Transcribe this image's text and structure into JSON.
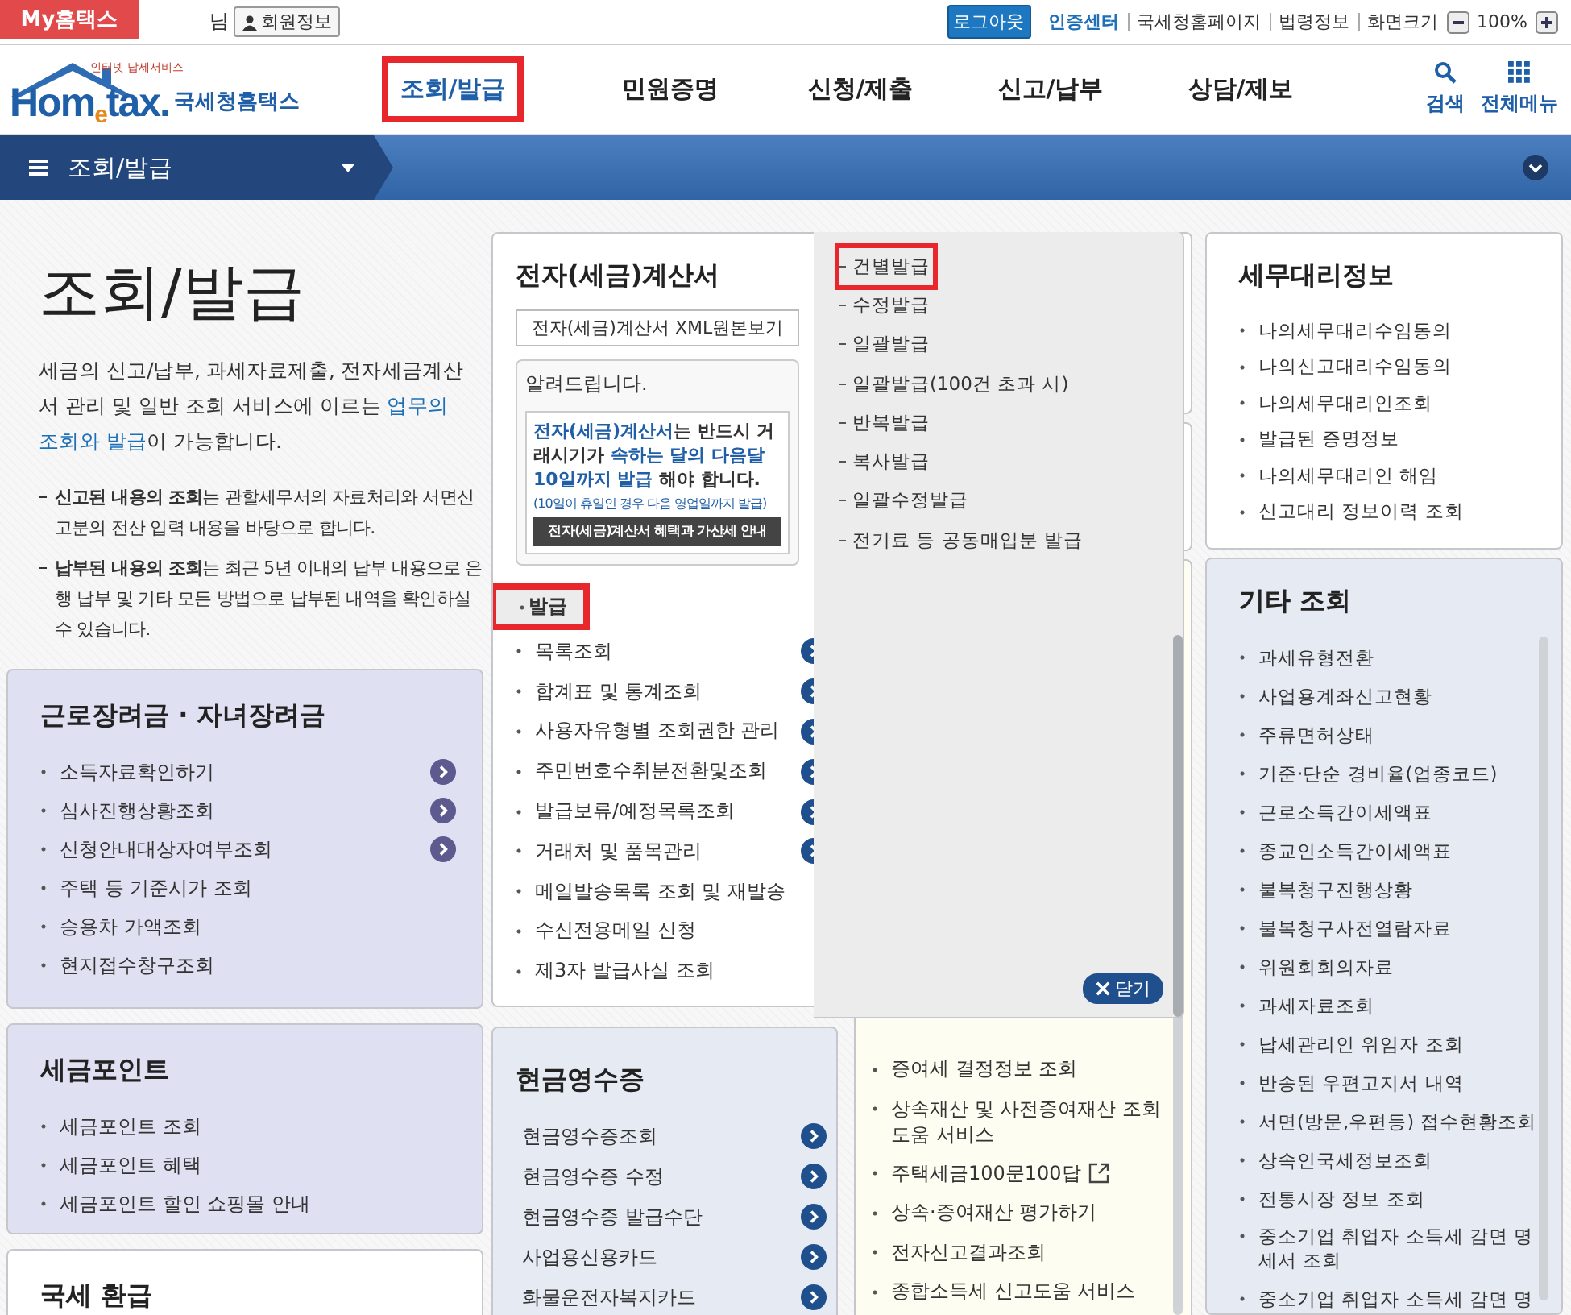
{
  "top_bar": {
    "my_button": "My홈택스",
    "user_suffix": "님",
    "member_button": "회원정보",
    "logout_button": "로그아웃",
    "links": [
      {
        "label": "인증센터",
        "emphasis": true
      },
      {
        "label": "국세청홈페이지",
        "emphasis": false
      },
      {
        "label": "법령정보",
        "emphasis": false
      }
    ],
    "zoom_label": "화면크기",
    "zoom_value": "100%"
  },
  "header": {
    "tagline": "인터넷 납세서비스",
    "wordmark": "Hom$_{e}$tax.",
    "site_name": "국세청홈택스",
    "nav": [
      {
        "label": "조회/발급",
        "selected": true,
        "highlighted": true
      },
      {
        "label": "민원증명",
        "selected": false,
        "highlighted": false
      },
      {
        "label": "신청/제출",
        "selected": false,
        "highlighted": false
      },
      {
        "label": "신고/납부",
        "selected": false,
        "highlighted": false
      },
      {
        "label": "상담/제보",
        "selected": false,
        "highlighted": false
      }
    ],
    "tools": [
      {
        "label": "검색",
        "kind": "search"
      },
      {
        "label": "전체메뉴",
        "kind": "menu"
      }
    ]
  },
  "section_bar": {
    "label": "조회/발급"
  },
  "intro": {
    "title": "조회/발급",
    "before": "세금의 신고/납부, 과세자료제출, 전자세금계산서 관리 및 일반 조회 서비스에 이르는 ",
    "link": "업무의 조회와 발급",
    "after": "이 가능합니다.",
    "notes": [
      "**신고된 내용의 조회**는 관할세무서의 자료처리와 서면신고분의 전산 입력 내용을 바탕으로 합니다.",
      "**납부된 내용의 조회**는 최근 5년 이내의 납부 내용으로 은행 납부 및 기타 모든 방법으로 납부된 내역을 확인하실 수 있습니다."
    ]
  },
  "left_cards": [
    {
      "title": "근로장려금 · 자녀장려금",
      "kind": "lavender",
      "items": [
        {
          "label": "소득자료확인하기",
          "has_arrow": true
        },
        {
          "label": "심사진행상황조회",
          "has_arrow": true
        },
        {
          "label": "신청안내대상자여부조회",
          "has_arrow": true
        },
        {
          "label": "주택 등 기준시가 조회",
          "has_arrow": false
        },
        {
          "label": "승용차 가액조회",
          "has_arrow": false
        },
        {
          "label": "현지접수창구조회",
          "has_arrow": false
        }
      ]
    },
    {
      "title": "세금포인트",
      "kind": "lavender",
      "items": [
        {
          "label": "세금포인트 조회",
          "has_arrow": false
        },
        {
          "label": "세금포인트 혜택",
          "has_arrow": false
        },
        {
          "label": "세금포인트 할인 쇼핑몰 안내",
          "has_arrow": false
        }
      ]
    },
    {
      "title": "국세 환급",
      "kind": "white"
    }
  ],
  "invoice_card": {
    "title": "전자(세금)계산서",
    "xml_button": "전자(세금)계산서 XML원본보기",
    "notice_title": "알려드립니다.",
    "notice_segments": [
      {
        "text": "전자(세금)계산서",
        "emphasis": true
      },
      {
        "text": "는 반드시 거래시기가 ",
        "emphasis": false
      },
      {
        "text": "속하는 달의 다음달 10일까지 발급",
        "emphasis": true
      },
      {
        "text": " 해야 합니다.",
        "emphasis": false
      }
    ],
    "notice_note": "(10일이 휴일인 경우 다음 영업일까지 발급)",
    "notice_button": "전자(세금)계산서 혜택과 가산세 안내",
    "group": {
      "label": "발급",
      "selected": true,
      "highlighted": true
    },
    "items": [
      {
        "label": "목록조회",
        "has_arrow": true
      },
      {
        "label": "합계표 및 통계조회",
        "has_arrow": true
      },
      {
        "label": "사용자유형별 조회권한 관리",
        "has_arrow": true
      },
      {
        "label": "주민번호수취분전환및조회",
        "has_arrow": true
      },
      {
        "label": "발급보류/예정목록조회",
        "has_arrow": true
      },
      {
        "label": "거래처 및 품목관리",
        "has_arrow": true
      },
      {
        "label": "메일발송목록 조회 및 재발송",
        "has_arrow": false
      },
      {
        "label": "수신전용메일 신청",
        "has_arrow": false
      },
      {
        "label": "제3자 발급사실 조회",
        "has_arrow": false
      }
    ]
  },
  "issue_popup": {
    "items": [
      {
        "label": "건별발급",
        "highlighted": true
      },
      {
        "label": "수정발급",
        "highlighted": false
      },
      {
        "label": "일괄발급",
        "highlighted": false
      },
      {
        "label": "일괄발급(100건 초과 시)",
        "highlighted": false
      },
      {
        "label": "반복발급",
        "highlighted": false
      },
      {
        "label": "복사발급",
        "highlighted": false
      },
      {
        "label": "일괄수정발급",
        "highlighted": false
      },
      {
        "label": "전기료 등 공동매입분 발급",
        "highlighted": false
      }
    ],
    "close_button": "닫기"
  },
  "cash_receipt_card": {
    "title": "현금영수증",
    "kind": "blue",
    "items": [
      {
        "label": "현금영수증조회",
        "has_arrow": true
      },
      {
        "label": "현금영수증 수정",
        "has_arrow": true
      },
      {
        "label": "현금영수증 발급수단",
        "has_arrow": true
      },
      {
        "label": "사업용신용카드",
        "has_arrow": true
      },
      {
        "label": "화물운전자복지카드",
        "has_arrow": true
      }
    ]
  },
  "other_card": {
    "items": [
      {
        "label": "증여세 결정정보 조회",
        "external": false
      },
      {
        "label": "상속재산 및 사전증여재산 조회 도움 서비스",
        "external": false
      },
      {
        "label": "주택세금100문100답",
        "external": true
      },
      {
        "label": "상속·증여재산 평가하기",
        "external": false
      },
      {
        "label": "전자신고결과조회",
        "external": false
      },
      {
        "label": "종합소득세 신고도움 서비스",
        "external": false
      }
    ]
  },
  "right_cards": [
    {
      "title": "세무대리정보",
      "kind": "white",
      "items": [
        "나의세무대리수임동의",
        "나의신고대리수임동의",
        "나의세무대리인조회",
        "발급된 증명정보",
        "나의세무대리인 해임",
        "신고대리 정보이력 조회"
      ]
    },
    {
      "title": "기타 조회",
      "kind": "blue",
      "items": [
        "과세유형전환",
        "사업용계좌신고현황",
        "주류면허상태",
        "기준·단순 경비율(업종코드)",
        "근로소득간이세액표",
        "종교인소득간이세액표",
        "불복청구진행상황",
        "불복청구사전열람자료",
        "위원회회의자료",
        "과세자료조회",
        "납세관리인 위임자 조회",
        "반송된 우편고지서 내역",
        "서면(방문,우편등) 접수현황조회",
        "상속인국세정보조회",
        "전통시장 정보 조회",
        "중소기업 취업자 소득세 감면 명세서 조회",
        "중소기업 취업자 소득세 감면 명"
      ]
    }
  ]
}
